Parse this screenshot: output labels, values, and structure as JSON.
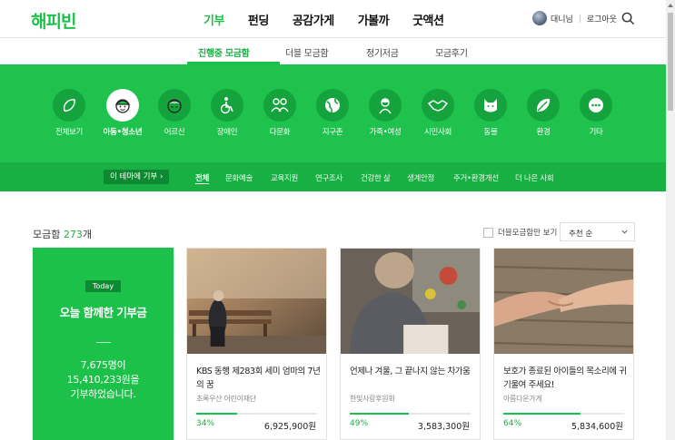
{
  "header": {
    "logo": "해피빈",
    "nav": [
      "기부",
      "펀딩",
      "공감가게",
      "가볼까",
      "굿액션"
    ],
    "username": "대니님",
    "logout": "로그아웃"
  },
  "subtabs": [
    "진행중 모금함",
    "더블 모금함",
    "정기저금",
    "모금후기"
  ],
  "categories": [
    "전체보기",
    "아동•청소년",
    "어르신",
    "장애인",
    "다문화",
    "지구촌",
    "가족•여성",
    "시민사회",
    "동물",
    "환경",
    "기타"
  ],
  "theme_button": "이 테마에 기부 ›",
  "subcategories": [
    "전체",
    "문화예술",
    "교육지원",
    "연구조사",
    "건강한 삶",
    "생계안정",
    "주거•환경개선",
    "더 나은 사회"
  ],
  "content": {
    "count_prefix": "모금함 ",
    "count_number": "273",
    "count_suffix": "개",
    "double_only": "더블모금함만 보기",
    "sort": "추천 순"
  },
  "today": {
    "badge": "Today",
    "title": "오늘 함께한 기부금",
    "line1": "7,675명이",
    "line2": "15,410,233원을",
    "line3": "기부하었습니다."
  },
  "cards": [
    {
      "title": "KBS 동행 제283회 세미 엄마의 7년의 꿈",
      "org": "초록우산 어린이재단",
      "percent_label": "34%",
      "percent": 34,
      "amount": "6,925,900원"
    },
    {
      "title": "언제나 겨울, 그 끝나지 않는 차가움",
      "org": "한빛사랑후원회",
      "percent_label": "49%",
      "percent": 49,
      "amount": "3,583,300원"
    },
    {
      "title": "보호가 종료된 아이들의 목소리에 귀 기울여 주세요!",
      "org": "아름다운가게",
      "percent_label": "64%",
      "percent": 64,
      "amount": "5,834,600원"
    }
  ],
  "colors": {
    "accent": "#1cc14a",
    "band": "#1ec24c",
    "band_dark": "#18b043"
  }
}
